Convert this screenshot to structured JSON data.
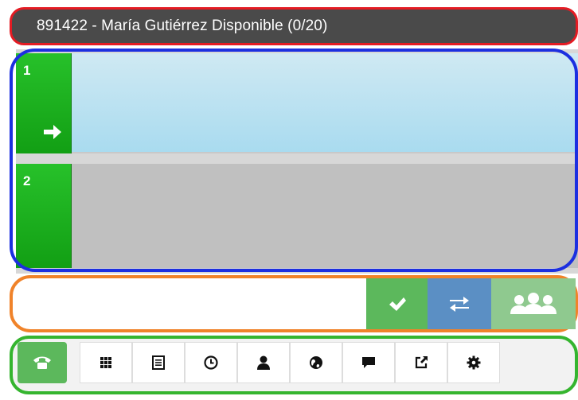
{
  "header": {
    "title": "891422 - María Gutiérrez  Disponible (0/20)"
  },
  "lines": [
    {
      "number": "1",
      "active": true,
      "icon": "arrow-right-icon"
    },
    {
      "number": "2",
      "active": false
    }
  ],
  "dial": {
    "input_value": "",
    "buttons": [
      {
        "name": "accept",
        "icon": "check-icon",
        "color": "#5cb85c"
      },
      {
        "name": "transfer",
        "icon": "transfer-icon",
        "color": "#5b8fc4"
      },
      {
        "name": "conference",
        "icon": "users-icon",
        "color": "#8fc98f"
      }
    ]
  },
  "toolbar": {
    "items": [
      {
        "icon": "phone-icon",
        "active": true
      },
      {
        "icon": "keypad-icon"
      },
      {
        "icon": "list-icon"
      },
      {
        "icon": "clock-icon"
      },
      {
        "icon": "user-icon"
      },
      {
        "icon": "globe-icon"
      },
      {
        "icon": "chat-icon"
      },
      {
        "icon": "share-icon"
      },
      {
        "icon": "gear-icon"
      }
    ]
  },
  "colors": {
    "header_bg": "#4a4a4a",
    "line_tab": "#1fb021",
    "line1_bg": "#bde3f2",
    "line2_bg": "#c0c0c0",
    "highlight_red": "#e41b23",
    "highlight_blue": "#1c2fe0",
    "highlight_orange": "#f0832a",
    "highlight_green": "#35b52f"
  }
}
